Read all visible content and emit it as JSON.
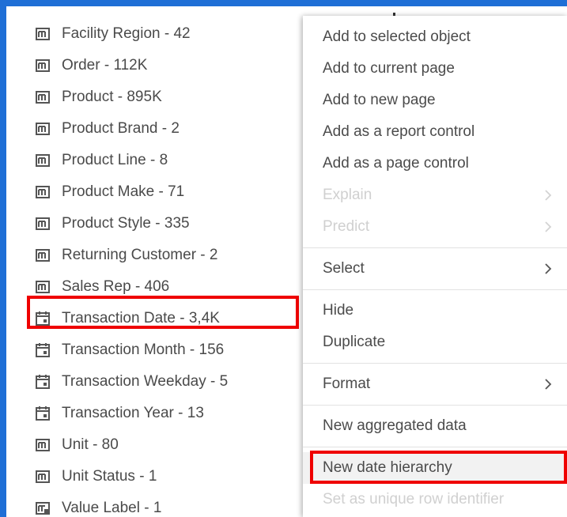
{
  "fields": [
    {
      "label": "Facility Region - 42",
      "icon": "category-icon"
    },
    {
      "label": "Order - 112K",
      "icon": "category-icon"
    },
    {
      "label": "Product - 895K",
      "icon": "category-icon"
    },
    {
      "label": "Product Brand - 2",
      "icon": "category-icon"
    },
    {
      "label": "Product Line - 8",
      "icon": "category-icon"
    },
    {
      "label": "Product Make - 71",
      "icon": "category-icon"
    },
    {
      "label": "Product Style - 335",
      "icon": "category-icon"
    },
    {
      "label": "Returning Customer - 2",
      "icon": "category-icon"
    },
    {
      "label": "Sales Rep - 406",
      "icon": "category-icon"
    },
    {
      "label": "Transaction Date - 3,4K",
      "icon": "calendar-icon"
    },
    {
      "label": "Transaction Month - 156",
      "icon": "calendar-icon"
    },
    {
      "label": "Transaction Weekday - 5",
      "icon": "calendar-icon"
    },
    {
      "label": "Transaction Year - 13",
      "icon": "calendar-icon"
    },
    {
      "label": "Unit - 80",
      "icon": "category-icon"
    },
    {
      "label": "Unit Status - 1",
      "icon": "category-icon"
    },
    {
      "label": "Value Label - 1",
      "icon": "label-category-icon"
    }
  ],
  "menu": [
    {
      "label": "Add to selected object",
      "disabled": false
    },
    {
      "label": "Add to current page",
      "disabled": false
    },
    {
      "label": "Add to new page",
      "disabled": false
    },
    {
      "label": "Add as a report control",
      "disabled": false
    },
    {
      "label": "Add as a page control",
      "disabled": false
    },
    {
      "label": "Explain",
      "disabled": true,
      "submenu": true
    },
    {
      "label": "Predict",
      "disabled": true,
      "submenu": true
    },
    {
      "label": "Select",
      "disabled": false,
      "submenu": true
    },
    {
      "label": "Hide",
      "disabled": false
    },
    {
      "label": "Duplicate",
      "disabled": false
    },
    {
      "label": "Format",
      "disabled": false,
      "submenu": true
    },
    {
      "label": "New aggregated data",
      "disabled": false
    },
    {
      "label": "New date hierarchy",
      "disabled": false,
      "highlighted": true
    },
    {
      "label": "Set as unique row identifier",
      "disabled": true
    }
  ],
  "colors": {
    "outer_background": "#1f6fd6",
    "panel_background": "#ffffff",
    "text": "#4a4a4a",
    "disabled_text": "#d0d0d0",
    "highlight_border": "#ef0000"
  }
}
